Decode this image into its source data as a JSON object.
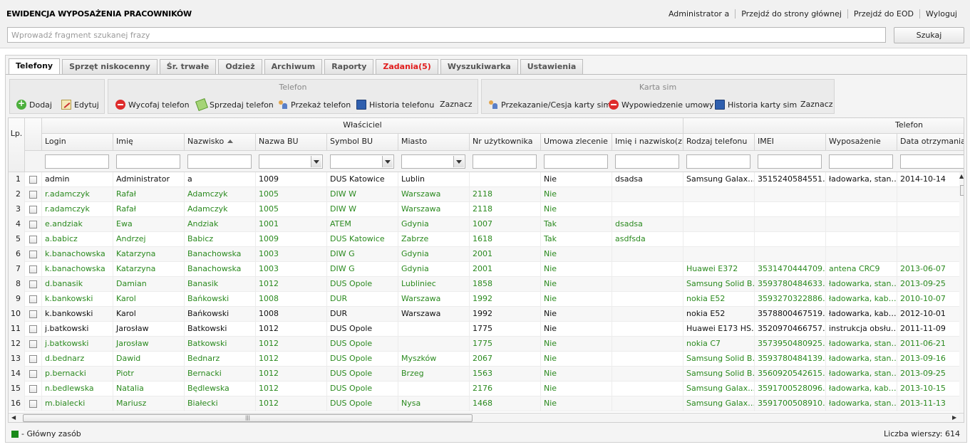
{
  "app": {
    "title": "EWIDENCJA WYPOSAŻENIA PRACOWNIKÓW",
    "links": [
      "Administrator a",
      "Przejdź do strony głównej",
      "Przejdź do EOD",
      "Wyloguj"
    ]
  },
  "search": {
    "placeholder": "Wprowadź fragment szukanej frazy",
    "button": "Szukaj"
  },
  "tabs": [
    {
      "label": "Telefony",
      "active": true
    },
    {
      "label": "Sprzęt niskocenny"
    },
    {
      "label": "Śr. trwałe"
    },
    {
      "label": "Odzież"
    },
    {
      "label": "Archiwum"
    },
    {
      "label": "Raporty"
    },
    {
      "label": "Zadania(5)",
      "alert": true
    },
    {
      "label": "Wyszukiwarka"
    },
    {
      "label": "Ustawienia"
    }
  ],
  "toolbar": {
    "general": {
      "add": "Dodaj",
      "edit": "Edytuj"
    },
    "phone": {
      "title": "Telefon",
      "withdraw": "Wycofaj telefon",
      "sell": "Sprzedaj telefon",
      "transfer": "Przekaż telefon",
      "history": "Historia telefonu",
      "mark": "Zaznacz"
    },
    "sim": {
      "title": "Karta sim",
      "transfer": "Przekazanie/Cesja karty sim",
      "terminate": "Wypowiedzenie umowy",
      "history": "Historia karty sim",
      "mark": "Zaznacz"
    }
  },
  "grid": {
    "lp_header": "Lp.",
    "groups": {
      "owner": "Właściciel",
      "phone": "Telefon"
    },
    "columns": [
      "Login",
      "Imię",
      "Nazwisko",
      "Nazwa BU",
      "Symbol BU",
      "Miasto",
      "Nr użytkownika",
      "Umowa zlecenie",
      "Imię i nazwisko(zlec",
      "Rodzaj telefonu",
      "IMEI",
      "Wyposażenie",
      "Data otrzymania"
    ],
    "rows": [
      {
        "lp": "1",
        "style": "black",
        "alt": false,
        "cells": [
          "admin",
          "Administrator",
          "a",
          "1009",
          "DUS Katowice",
          "Lublin",
          "",
          "Nie",
          "dsadsa",
          "Samsung Galax…",
          "3515240584551…",
          "ładowarka, stan…",
          "2014-10-14"
        ]
      },
      {
        "lp": "2",
        "style": "green",
        "alt": true,
        "cells": [
          "r.adamczyk",
          "Rafał",
          "Adamczyk",
          "1005",
          "DIW W",
          "Warszawa",
          "2118",
          "Nie",
          "",
          "",
          "",
          "",
          ""
        ]
      },
      {
        "lp": "3",
        "style": "green",
        "alt": false,
        "cells": [
          "r.adamczyk",
          "Rafał",
          "Adamczyk",
          "1005",
          "DIW W",
          "Warszawa",
          "2118",
          "Nie",
          "",
          "",
          "",
          "",
          ""
        ]
      },
      {
        "lp": "4",
        "style": "green",
        "alt": true,
        "cells": [
          "e.andziak",
          "Ewa",
          "Andziak",
          "1001",
          "ATEM",
          "Gdynia",
          "1007",
          "Tak",
          "dsadsa",
          "",
          "",
          "",
          ""
        ]
      },
      {
        "lp": "5",
        "style": "green",
        "alt": false,
        "cells": [
          "a.babicz",
          "Andrzej",
          "Babicz",
          "1009",
          "DUS Katowice",
          "Zabrze",
          "1618",
          "Tak",
          "asdfsda",
          "",
          "",
          "",
          ""
        ]
      },
      {
        "lp": "6",
        "style": "green",
        "alt": true,
        "cells": [
          "k.banachowska",
          "Katarzyna",
          "Banachowska",
          "1003",
          "DIW G",
          "Gdynia",
          "2001",
          "Nie",
          "",
          "",
          "",
          "",
          ""
        ]
      },
      {
        "lp": "7",
        "style": "green",
        "alt": false,
        "cells": [
          "k.banachowska",
          "Katarzyna",
          "Banachowska",
          "1003",
          "DIW G",
          "Gdynia",
          "2001",
          "Nie",
          "",
          "Huawei E372",
          "3531470444709…",
          "antena CRC9",
          "2013-06-07"
        ]
      },
      {
        "lp": "8",
        "style": "green",
        "alt": true,
        "cells": [
          "d.banasik",
          "Damian",
          "Banasik",
          "1012",
          "DUS Opole",
          "Lubliniec",
          "1858",
          "Nie",
          "",
          "Samsung Solid B…",
          "3593780484633…",
          "ładowarka, stan…",
          "2013-09-25"
        ]
      },
      {
        "lp": "9",
        "style": "green",
        "alt": false,
        "cells": [
          "k.bankowski",
          "Karol",
          "Bańkowski",
          "1008",
          "DUR",
          "Warszawa",
          "1992",
          "Nie",
          "",
          "nokia E52",
          "3593270322886…",
          "ładowarka, kab…",
          "2010-10-07"
        ]
      },
      {
        "lp": "10",
        "style": "black",
        "alt": true,
        "cells": [
          "k.bankowski",
          "Karol",
          "Bańkowski",
          "1008",
          "DUR",
          "Warszawa",
          "1992",
          "Nie",
          "",
          "nokia E52",
          "3578800467519…",
          "ładowarka, kab…",
          "2012-10-01"
        ]
      },
      {
        "lp": "11",
        "style": "black",
        "alt": false,
        "cells": [
          "j.batkowski",
          "Jarosław",
          "Batkowski",
          "1012",
          "DUS Opole",
          "",
          "1775",
          "Nie",
          "",
          "Huawei E173 HS…",
          "3520970466757…",
          "instrukcja obsłu…",
          "2011-11-09"
        ]
      },
      {
        "lp": "12",
        "style": "green",
        "alt": true,
        "cells": [
          "j.batkowski",
          "Jarosław",
          "Batkowski",
          "1012",
          "DUS Opole",
          "",
          "1775",
          "Nie",
          "",
          "nokia C7",
          "3573950480925…",
          "ładowarka, stan…",
          "2011-06-21"
        ]
      },
      {
        "lp": "13",
        "style": "green",
        "alt": false,
        "cells": [
          "d.bednarz",
          "Dawid",
          "Bednarz",
          "1012",
          "DUS Opole",
          "Myszków",
          "2067",
          "Nie",
          "",
          "Samsung Solid B…",
          "3593780484139…",
          "ładowarka, stan…",
          "2013-09-16"
        ]
      },
      {
        "lp": "14",
        "style": "green",
        "alt": true,
        "cells": [
          "p.bernacki",
          "Piotr",
          "Bernacki",
          "1012",
          "DUS Opole",
          "Brzeg",
          "1563",
          "Nie",
          "",
          "Samsung Solid B…",
          "3560920542615…",
          "ładowarka, stan…",
          "2013-09-25"
        ]
      },
      {
        "lp": "15",
        "style": "green",
        "alt": false,
        "cells": [
          "n.bedlewska",
          "Natalia",
          "Będlewska",
          "1012",
          "DUS Opole",
          "",
          "2176",
          "Nie",
          "",
          "Samsung Galax…",
          "3591700528096…",
          "ładowarka, kab…",
          "2013-10-15"
        ]
      },
      {
        "lp": "16",
        "style": "green",
        "alt": true,
        "cells": [
          "m.bialecki",
          "Mariusz",
          "Białecki",
          "1012",
          "DUS Opole",
          "Nysa",
          "1468",
          "Nie",
          "",
          "Samsung Galax…",
          "3591700508910…",
          "ładowarka, stan…",
          "2013-11-13"
        ]
      }
    ]
  },
  "footer": {
    "legend": "- Główny zasób",
    "rowcount": "Liczba wierszy: 614"
  },
  "colors": {
    "green_row": "#2b8a1f",
    "alert_tab": "#e11d1d",
    "legend_square": "#1a8a1a"
  }
}
